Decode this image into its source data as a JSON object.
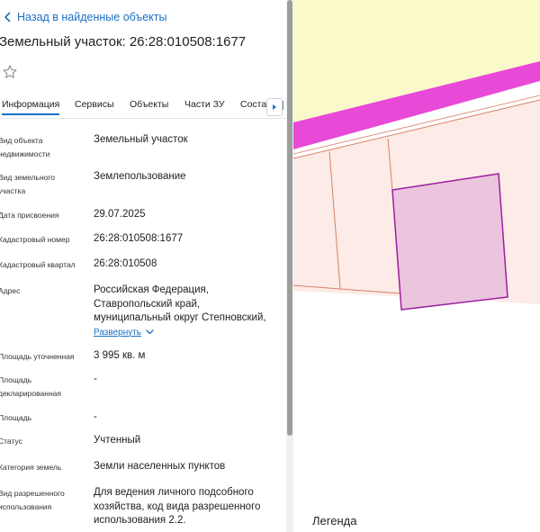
{
  "nav": {
    "back_label": "Назад в найденные объекты"
  },
  "object": {
    "title": "Земельный участок: 26:28:010508:1677"
  },
  "tabs": [
    {
      "label": "Информация",
      "active": true
    },
    {
      "label": "Сервисы"
    },
    {
      "label": "Объекты"
    },
    {
      "label": "Части ЗУ"
    },
    {
      "label": "Соста"
    }
  ],
  "info": {
    "object_type": {
      "label": "Вид объекта недвижимости",
      "value": "Земельный участок"
    },
    "land_type": {
      "label": "Вид земельного участка",
      "value": "Землепользование"
    },
    "assign_date": {
      "label": "Дата присвоения",
      "value": "29.07.2025"
    },
    "cadastral_number": {
      "label": "Кадастровый номер",
      "value": "26:28:010508:1677"
    },
    "cadastral_block": {
      "label": "Кадастровый квартал",
      "value": "26:28:010508"
    },
    "address": {
      "label": "Адрес",
      "lines": [
        "Российская Федерация,",
        "Ставропольский край,",
        "муниципальный округ Степновский,"
      ],
      "expand_label": "Развернуть"
    },
    "area_specified": {
      "label": "Площадь уточненная",
      "value": "3 995 кв. м"
    },
    "area_declared": {
      "label": "Площадь декларированная",
      "value": "-"
    },
    "area": {
      "label": "Площадь",
      "value": "-"
    },
    "status": {
      "label": "Статус",
      "value": "Учтенный"
    },
    "land_category": {
      "label": "Категория земель",
      "value": "Земли населенных пунктов"
    },
    "permitted_use": {
      "label": "Вид разрешенного использования",
      "lines": [
        "Для ведения личного подсобного",
        "хозяйства, код вида разрешенного",
        "использования 2.2."
      ]
    }
  },
  "map": {
    "legend_title": "Легенда",
    "colors": {
      "zone_yellow": "#fbf8c9",
      "road_magenta": "#e84ad8",
      "parcels_fill": "#fcebe6",
      "parcel_border": "#d98068",
      "selected_fill": "#ebc4de",
      "selected_border": "#9d1fa0"
    }
  }
}
